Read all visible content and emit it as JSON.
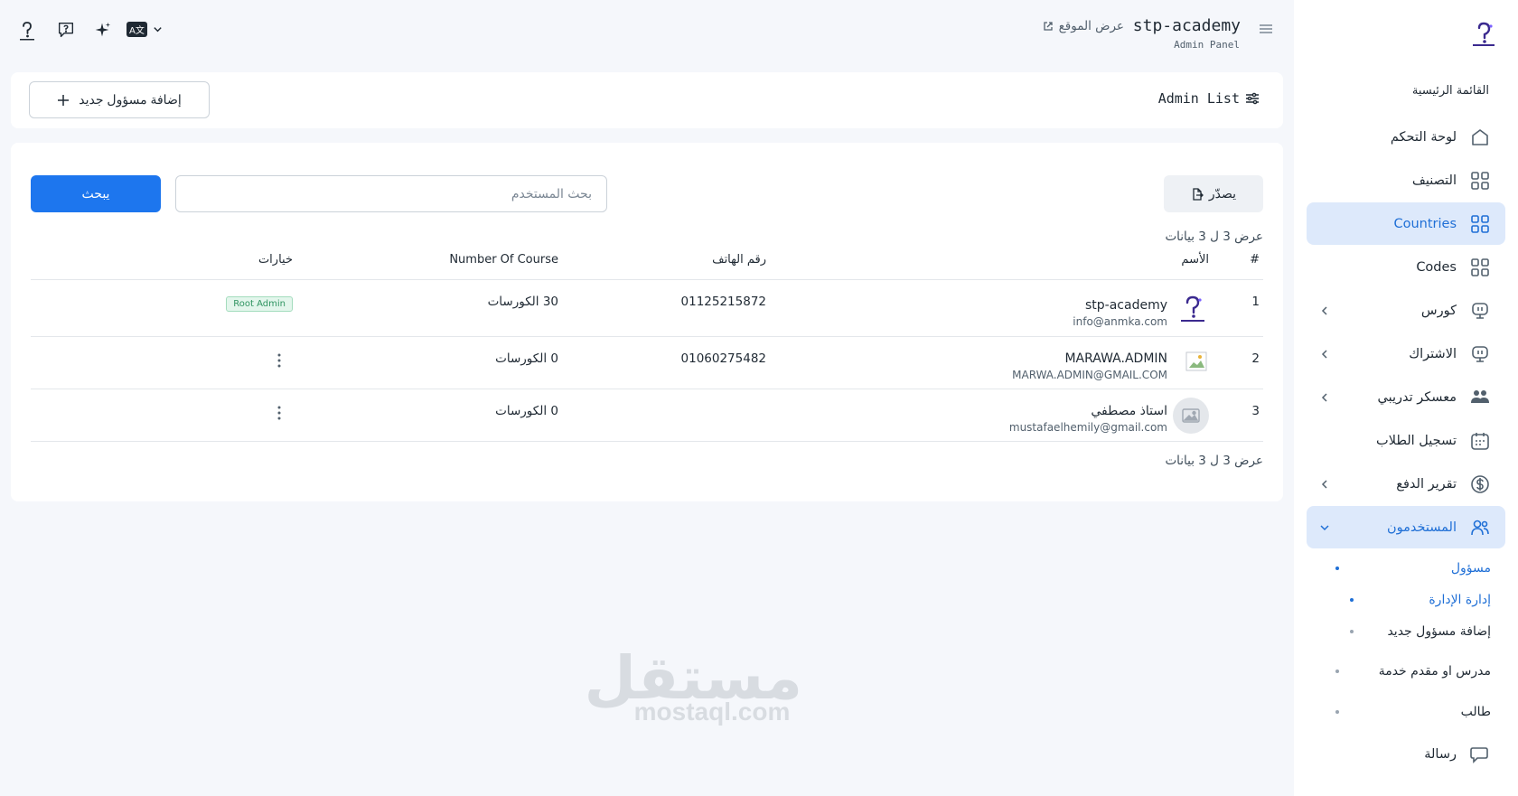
{
  "brand": {
    "title": "stp-academy",
    "subtitle": "Admin Panel"
  },
  "topbar": {
    "view_site": "عرض الموقع",
    "language_badge": "A文"
  },
  "header": {
    "title": "Admin List",
    "add_button": "إضافة مسؤول جديد"
  },
  "toolbar": {
    "export_label": "يصدّر",
    "search_placeholder": "بحث المستخدم",
    "search_button": "يبحث"
  },
  "summary": {
    "top": "عرض 3 ل 3 بيانات",
    "bottom": "عرض 3 ل 3 بيانات"
  },
  "table": {
    "headers": {
      "index": "#",
      "name": "الأسم",
      "phone": "رقم الهاتف",
      "courses": "Number Of Course",
      "options": "خيارات"
    },
    "rows": [
      {
        "index": "1",
        "name": "stp-academy",
        "email": "info@anmka.com",
        "phone": "01125215872",
        "courses": "30 الكورسات",
        "badge": "Root Admin"
      },
      {
        "index": "2",
        "name": "MARAWA.ADMIN",
        "email": "MARWA.ADMIN@GMAIL.COM",
        "phone": "01060275482",
        "courses": "0 الكورسات"
      },
      {
        "index": "3",
        "name": "استاذ مصطفي",
        "email": "mustafaelhemily@gmail.com",
        "phone": "",
        "courses": "0 الكورسات"
      }
    ]
  },
  "sidebar": {
    "section": "القائمة الرئيسية",
    "items": [
      {
        "label": "لوحة التحكم",
        "icon": "home-icon"
      },
      {
        "label": "التصنيف",
        "icon": "grid-icon"
      },
      {
        "label": "Countries",
        "icon": "grid-icon",
        "active": true
      },
      {
        "label": "Codes",
        "icon": "grid-icon"
      },
      {
        "label": "كورس",
        "icon": "monitor-icon"
      },
      {
        "label": "الاشتراك",
        "icon": "monitor-icon"
      },
      {
        "label": "معسكر تدريبي",
        "icon": "group-icon"
      },
      {
        "label": "تسجيل الطلاب",
        "icon": "calendar-icon"
      },
      {
        "label": "تقرير الدفع",
        "icon": "dollar-icon"
      },
      {
        "label": "المستخدمون",
        "icon": "users-icon",
        "active": true
      }
    ],
    "users_sub": [
      {
        "label": "مسؤول",
        "active": true
      },
      {
        "label": "إدارة الإدارة",
        "active": true
      },
      {
        "label": "إضافة مسؤول جديد"
      },
      {
        "label": "مدرس او مقدم خدمة"
      },
      {
        "label": "طالب"
      }
    ],
    "message": "رسالة"
  },
  "watermark": {
    "arabic": "مستقل",
    "latin": "mostaql.com"
  },
  "colors": {
    "primary": "#1d76ee",
    "active_bg": "#dde9fb",
    "active_text": "#1f6fd6",
    "badge_bg": "#e3f6ec"
  }
}
